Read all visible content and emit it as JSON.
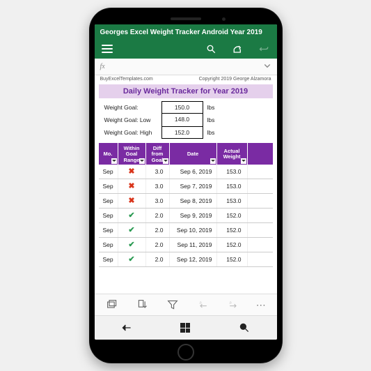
{
  "app": {
    "title": "Georges Excel Weight Tracker Android Year 2019"
  },
  "formula_bar": {
    "fx_label": "fx"
  },
  "sheet": {
    "meta_left": "BuyExcelTemplates.com",
    "meta_right": "Copyright 2019 George Alzamora",
    "title": "Daily Weight Tracker for Year 2019",
    "goals": [
      {
        "label": "Weight Goal:",
        "value": "150.0",
        "unit": "lbs"
      },
      {
        "label": "Weight Goal: Low",
        "value": "148.0",
        "unit": "lbs"
      },
      {
        "label": "Weight Goal: High",
        "value": "152.0",
        "unit": "lbs"
      }
    ],
    "headers": {
      "month": "Mo.",
      "within": "Within Goal Range",
      "diff": "Diff from Goal",
      "date": "Date",
      "actual": "Actual Weight"
    },
    "rows": [
      {
        "month": "Sep",
        "within": false,
        "diff": "3.0",
        "date": "Sep 6, 2019",
        "weight": "153.0"
      },
      {
        "month": "Sep",
        "within": false,
        "diff": "3.0",
        "date": "Sep 7, 2019",
        "weight": "153.0"
      },
      {
        "month": "Sep",
        "within": false,
        "diff": "3.0",
        "date": "Sep 8, 2019",
        "weight": "153.0"
      },
      {
        "month": "Sep",
        "within": true,
        "diff": "2.0",
        "date": "Sep 9, 2019",
        "weight": "152.0"
      },
      {
        "month": "Sep",
        "within": true,
        "diff": "2.0",
        "date": "Sep 10, 2019",
        "weight": "152.0"
      },
      {
        "month": "Sep",
        "within": true,
        "diff": "2.0",
        "date": "Sep 11, 2019",
        "weight": "152.0"
      },
      {
        "month": "Sep",
        "within": true,
        "diff": "2.0",
        "date": "Sep 12, 2019",
        "weight": "152.0"
      }
    ]
  }
}
